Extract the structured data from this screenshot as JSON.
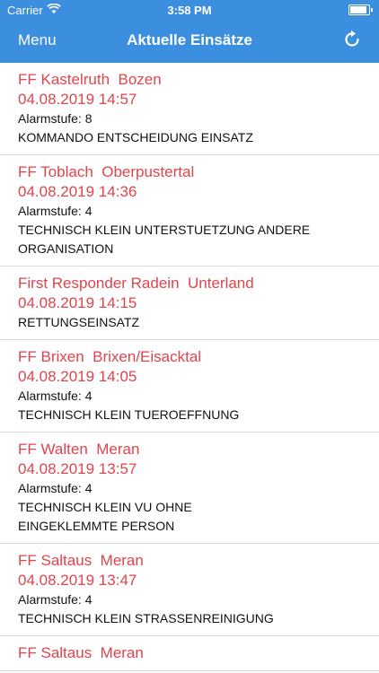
{
  "status_bar": {
    "carrier": "Carrier",
    "time": "3:58 PM"
  },
  "navbar": {
    "menu_label": "Menu",
    "title": "Aktuelle Einsätze",
    "refresh_icon": "refresh-icon"
  },
  "colors": {
    "bar": "#3b8fde",
    "accent_red": "#e0444c"
  },
  "incidents": [
    {
      "unit": "FF Kastelruth",
      "region": "Bozen",
      "datetime": "04.08.2019 14:57",
      "alarm": "Alarmstufe: 8",
      "type": [
        "KOMMANDO ENTSCHEIDUNG EINSATZ"
      ]
    },
    {
      "unit": "FF Toblach",
      "region": "Oberpustertal",
      "datetime": "04.08.2019 14:36",
      "alarm": "Alarmstufe: 4",
      "type": [
        "TECHNISCH KLEIN UNTERSTUETZUNG ANDERE",
        "ORGANISATION"
      ]
    },
    {
      "unit": "First Responder Radein",
      "region": "Unterland",
      "datetime": "04.08.2019 14:15",
      "alarm": "",
      "type": [
        "RETTUNGSEINSATZ"
      ]
    },
    {
      "unit": "FF Brixen",
      "region": "Brixen/Eisacktal",
      "datetime": "04.08.2019 14:05",
      "alarm": "Alarmstufe: 4",
      "type": [
        "TECHNISCH KLEIN TUEROEFFNUNG"
      ]
    },
    {
      "unit": "FF Walten",
      "region": "Meran",
      "datetime": "04.08.2019 13:57",
      "alarm": "Alarmstufe: 4",
      "type": [
        "TECHNISCH KLEIN VU OHNE",
        "EINGEKLEMMTE PERSON"
      ]
    },
    {
      "unit": "FF Saltaus",
      "region": "Meran",
      "datetime": "04.08.2019 13:47",
      "alarm": "Alarmstufe: 4",
      "type": [
        "TECHNISCH KLEIN STRASSENREINIGUNG"
      ]
    },
    {
      "unit": "FF Saltaus",
      "region": "Meran",
      "datetime": "",
      "alarm": "",
      "type": []
    }
  ]
}
